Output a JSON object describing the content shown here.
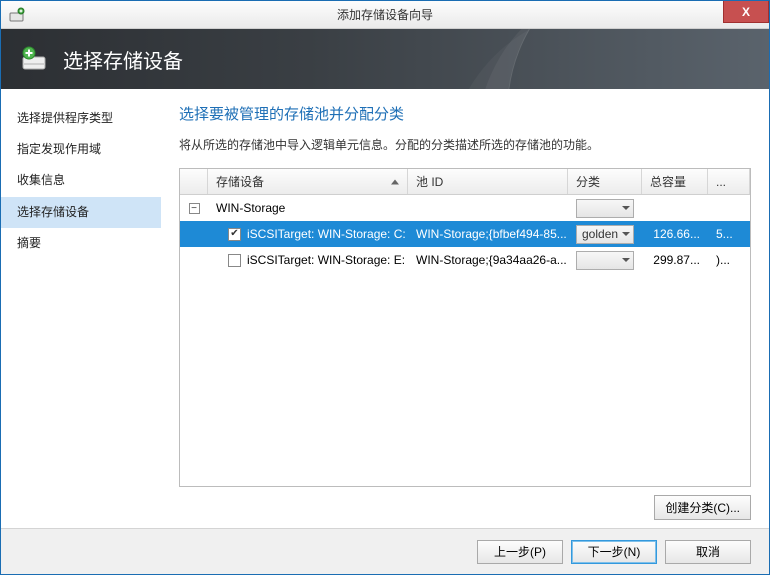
{
  "window": {
    "title": "添加存储设备向导",
    "close_label": "X"
  },
  "header": {
    "title": "选择存储设备"
  },
  "sidebar": {
    "items": [
      {
        "label": "选择提供程序类型",
        "selected": false
      },
      {
        "label": "指定发现作用域",
        "selected": false
      },
      {
        "label": "收集信息",
        "selected": false
      },
      {
        "label": "选择存储设备",
        "selected": true
      },
      {
        "label": "摘要",
        "selected": false
      }
    ]
  },
  "main": {
    "title": "选择要被管理的存储池并分配分类",
    "description": "将从所选的存储池中导入逻辑单元信息。分配的分类描述所选的存储池的功能。",
    "columns": {
      "device": "存储设备",
      "pool": "池 ID",
      "class": "分类",
      "capacity": "总容量",
      "more": "..."
    },
    "rows": [
      {
        "type": "group",
        "expanded": true,
        "device": "WIN-Storage",
        "class": "",
        "capacity": "",
        "more": ""
      },
      {
        "type": "item",
        "checked": true,
        "selected": true,
        "device": "iSCSITarget: WIN-Storage: C:",
        "pool": "WIN-Storage;{bfbef494-85...",
        "class": "golden",
        "capacity": "126.66...",
        "more": "5..."
      },
      {
        "type": "item",
        "checked": false,
        "selected": false,
        "device": "iSCSITarget: WIN-Storage: E:",
        "pool": "WIN-Storage;{9a34aa26-a...",
        "class": "",
        "capacity": "299.87...",
        "more": ")..."
      }
    ],
    "create_class_label": "创建分类(C)..."
  },
  "footer": {
    "prev": "上一步(P)",
    "next": "下一步(N)",
    "cancel": "取消"
  }
}
